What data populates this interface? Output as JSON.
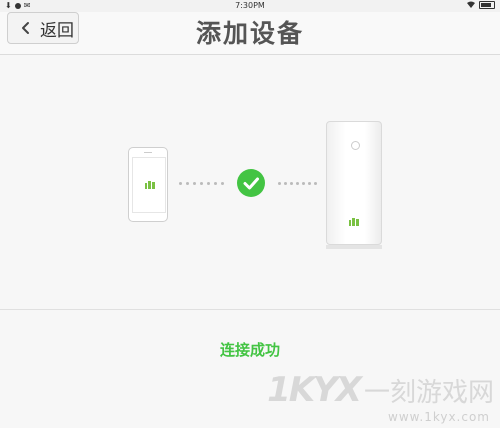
{
  "status_bar": {
    "time": "7:30PM"
  },
  "header": {
    "back_label": "返回",
    "title": "添加设备"
  },
  "connection": {
    "status_text": "连接成功",
    "accent_color": "#43c443"
  },
  "icons": {
    "back": "chevron-left-icon",
    "check": "check-icon",
    "phone": "phone-device",
    "router": "router-device",
    "wifi": "wifi-icon",
    "battery": "battery-icon"
  },
  "watermark": {
    "logo": "1KYX",
    "text": "一刻游戏网",
    "url": "www.1kyx.com"
  }
}
